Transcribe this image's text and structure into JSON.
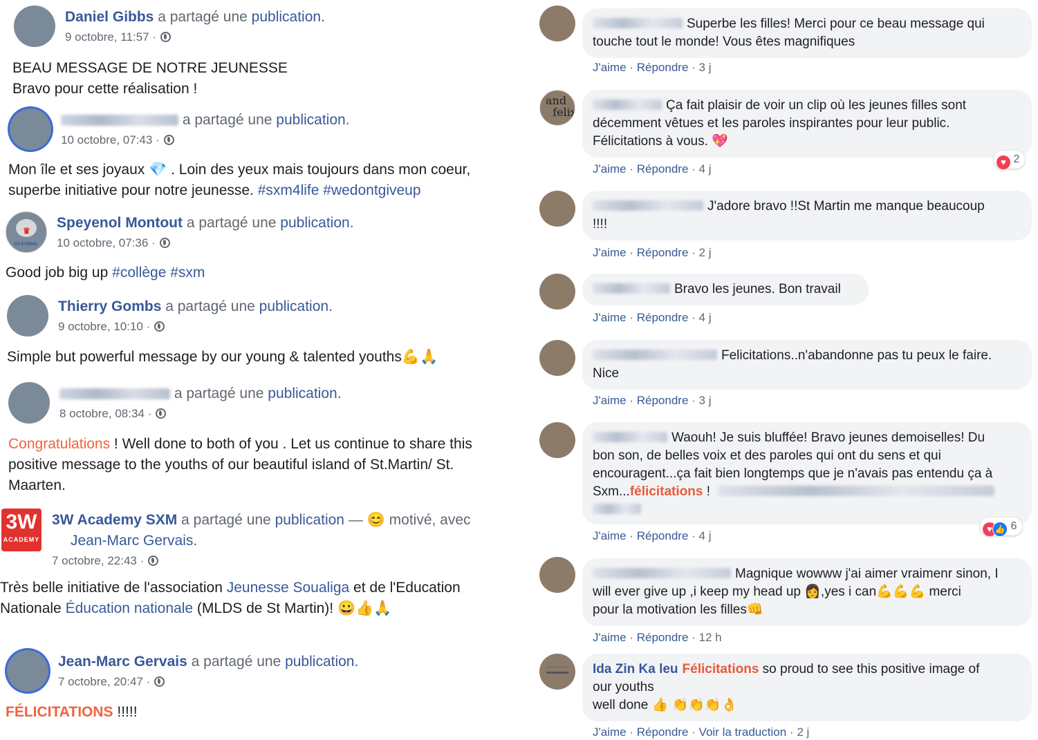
{
  "shares": [
    {
      "author": "Daniel Gibbs",
      "verb": "a partagé une",
      "link": "publication.",
      "time": "9 octobre, 11:57 ·",
      "lines": [
        "BEAU MESSAGE DE NOTRE JEUNESSE",
        "Bravo pour cette réalisation !"
      ]
    },
    {
      "author": "",
      "verb": "a partagé une",
      "link": "publication.",
      "time": "10 octobre, 07:43 ·",
      "line1_pre": "Mon île et ses joyaux",
      "line1_post": ". Loin des yeux mais toujours dans mon coeur,",
      "line2_pre": "superbe initiative pour notre jeunesse.",
      "tags": "#sxm4life #wedontgiveup"
    },
    {
      "author": "Speyenol Montout",
      "verb": "a partagé une",
      "link": "publication.",
      "time": "10 octobre, 07:36 ·",
      "text_pre": "Good job big up",
      "tags": "#collège #sxm",
      "avatar_label": "DJ EYEDOL"
    },
    {
      "author": "Thierry Gombs",
      "verb": "a partagé une",
      "link": "publication.",
      "time": "9 octobre, 10:10 ·",
      "text": "Simple but powerful message by our young & talented youths"
    },
    {
      "author": "",
      "verb": "a partagé une",
      "link": "publication.",
      "time": "8 octobre, 08:34 ·",
      "highlight": "Congratulations",
      "line1": " ! Well done to both of you . Let us continue to share this",
      "line2": "positive message to the youths of our beautiful island of St.Martin/ St.",
      "line3": "Maarten."
    },
    {
      "author": "3W Academy SXM",
      "verb": "a partagé une",
      "link": "publication",
      "feeling": "— 😊 motivé, avec",
      "with": "Jean-Marc Gervais.",
      "time": "7 octobre, 22:43 ·",
      "logo_text": "3W",
      "logo_sub": "ACADEMY",
      "line1_pre": "Très belle initiative de l'association",
      "line1_link": "Jeunesse Soualiga",
      "line1_post": "et de l'Education",
      "line2_pre": "Nationale",
      "line2_link": "Éducation nationale",
      "line2_post": "(MLDS de St Martin)! 😀👍🙏"
    },
    {
      "author": "Jean-Marc Gervais",
      "verb": "a partagé une",
      "link": "publication.",
      "time": "7 octobre, 20:47 ·",
      "highlight": "FÉLICITATIONS",
      "tail": " !!!!!"
    }
  ],
  "labels": {
    "like": "J'aime",
    "reply": "Répondre",
    "translate": "Voir la traduction",
    "dot": "·"
  },
  "comments": [
    {
      "lines": [
        "Superbe les filles! Merci pour ce beau message qui",
        "touche tout le monde! Vous êtes magnifiques"
      ],
      "age": "3 j"
    },
    {
      "lines": [
        "Ça fait plaisir de voir un clip où les jeunes filles sont",
        "décemment vêtues et les paroles inspirantes pour leur public.",
        "Félicitations à vous. 💖"
      ],
      "age": "4 j",
      "reactions": "2"
    },
    {
      "lines": [
        "J'adore bravo !!St Martin me manque beaucoup",
        "!!!!"
      ],
      "age": "2 j"
    },
    {
      "lines": [
        "Bravo les jeunes. Bon travail"
      ],
      "age": "4 j"
    },
    {
      "lines": [
        "Felicitations..n'abandonne pas tu peux le faire.",
        "Nice"
      ],
      "age": "3 j"
    },
    {
      "lines": [
        "Waouh! Je suis bluffée! Bravo jeunes demoiselles! Du",
        "bon son, de belles voix et des paroles qui ont du sens et qui",
        "encouragent...ça fait bien longtemps que je n'avais pas entendu ça à"
      ],
      "line4_pre": "Sxm...",
      "line4_hl": "félicitations",
      "line4_post": " !",
      "age": "4 j",
      "reactions": "6"
    },
    {
      "lines": [
        "Magnique wowww j'ai aimer vraimenr sinon, I",
        "will ever give up ,i keep my head up 👩,yes i can💪💪💪 merci",
        "pour la motivation les filles👊"
      ],
      "age": "12 h"
    },
    {
      "author": "Ida Zin Ka leu",
      "hl": "Félicitations",
      "lines": [
        " so proud to see this positive image of",
        "our youths",
        "well done 👍 👏👏👏👌"
      ],
      "age": "2 j"
    }
  ]
}
